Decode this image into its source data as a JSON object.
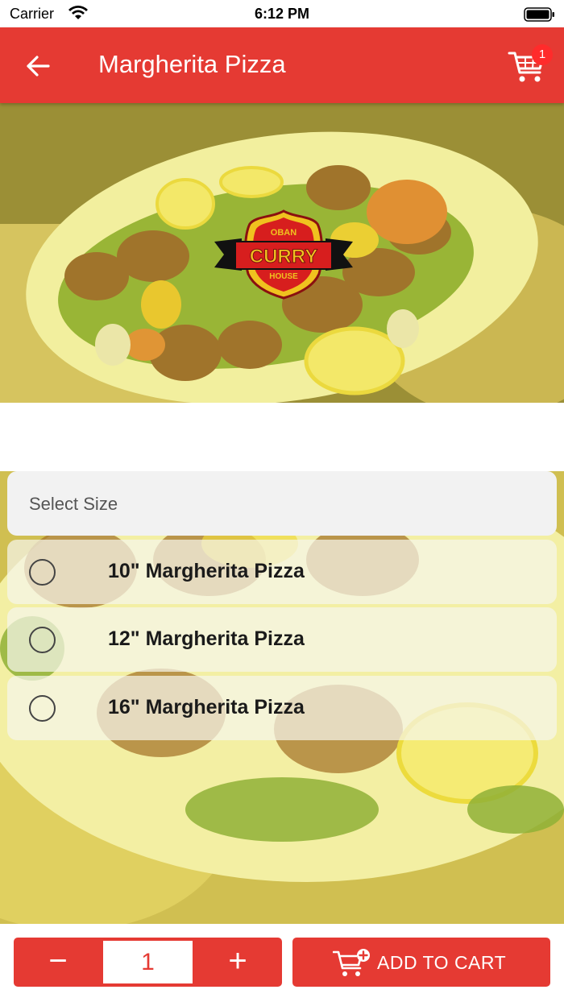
{
  "status_bar": {
    "carrier": "Carrier",
    "time": "6:12 PM"
  },
  "nav": {
    "title": "Margherita Pizza",
    "cart_count": "1",
    "back_icon": "arrow-left-icon",
    "cart_icon": "shopping-cart-icon"
  },
  "hero": {
    "logo_top": "OBAN",
    "logo_main": "CURRY",
    "logo_bottom": "HOUSE"
  },
  "options": {
    "header": "Select Size",
    "items": [
      {
        "label": "10\" Margherita Pizza",
        "selected": false
      },
      {
        "label": "12\" Margherita Pizza",
        "selected": false
      },
      {
        "label": "16\" Margherita Pizza",
        "selected": false
      }
    ]
  },
  "bottom": {
    "minus": "−",
    "quantity": "1",
    "plus": "+",
    "add_to_cart": "ADD TO CART"
  },
  "colors": {
    "accent": "#e53a33",
    "badge": "#ff2b2b"
  }
}
